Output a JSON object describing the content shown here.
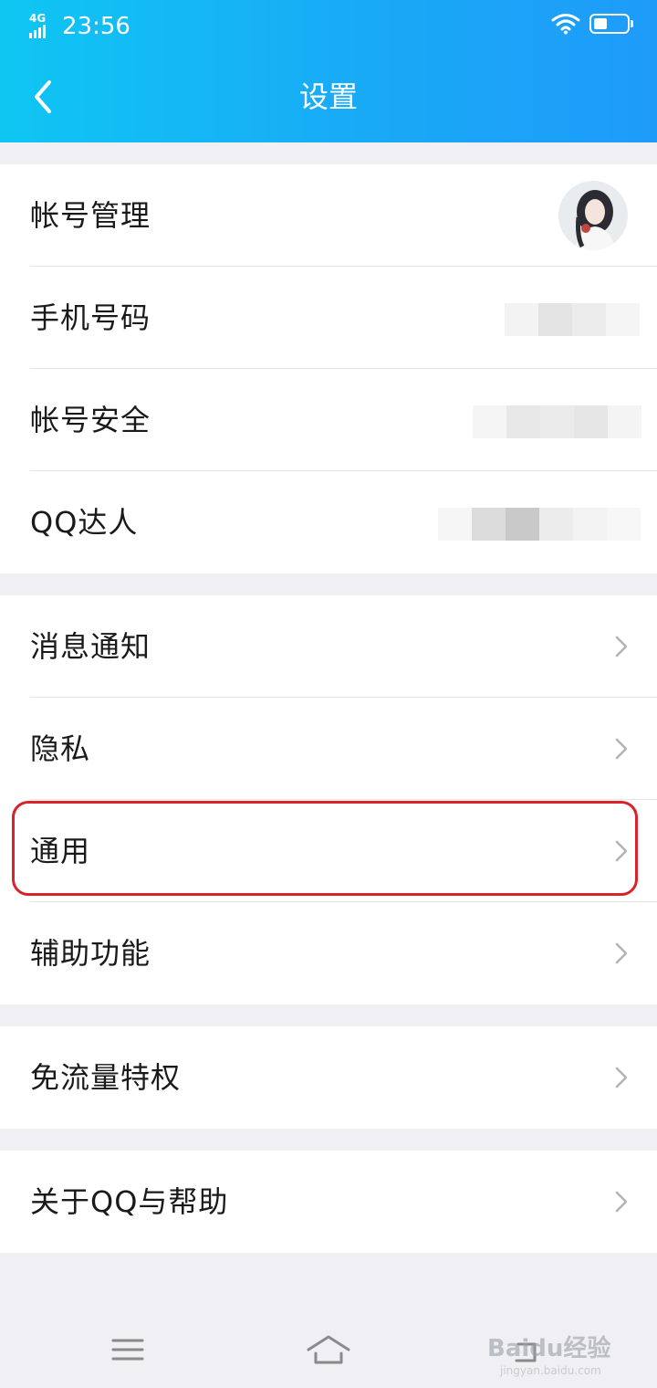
{
  "status_bar": {
    "network": "4G",
    "time": "23:56"
  },
  "header": {
    "title": "设置",
    "back_icon": "chevron-left-icon"
  },
  "groups": [
    {
      "items": [
        {
          "label": "帐号管理",
          "trailing": "avatar"
        },
        {
          "label": "手机号码",
          "trailing": "blurred-value"
        },
        {
          "label": "帐号安全",
          "trailing": "blurred-value"
        },
        {
          "label": "QQ达人",
          "trailing": "blurred-value"
        }
      ]
    },
    {
      "items": [
        {
          "label": "消息通知",
          "trailing": "chevron-right-icon"
        },
        {
          "label": "隐私",
          "trailing": "chevron-right-icon"
        },
        {
          "label": "通用",
          "trailing": "chevron-right-icon",
          "highlighted": true
        },
        {
          "label": "辅助功能",
          "trailing": "chevron-right-icon"
        }
      ]
    },
    {
      "items": [
        {
          "label": "免流量特权",
          "trailing": "chevron-right-icon"
        }
      ]
    },
    {
      "items": [
        {
          "label": "关于QQ与帮助",
          "trailing": "chevron-right-icon"
        }
      ]
    }
  ],
  "nav_bar": {
    "buttons": [
      "menu-icon",
      "home-icon",
      "back-icon"
    ]
  },
  "watermark": {
    "logo": "Baidu经验",
    "sub": "jingyan.baidu.com"
  },
  "colors": {
    "header_start": "#0fc6f3",
    "header_end": "#1e9bf9",
    "highlight": "#d8232a",
    "background": "#efeff4"
  }
}
